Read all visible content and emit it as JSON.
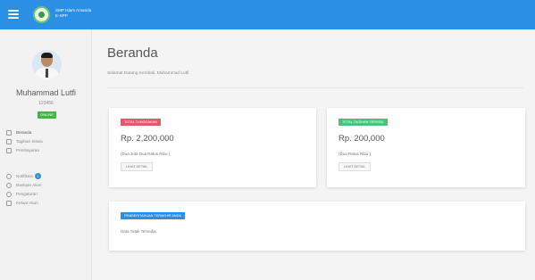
{
  "app": {
    "brand_line1": "SMP Islam Amanda",
    "brand_line2": "E-SPP"
  },
  "user": {
    "name": "Muhammad Lutfi",
    "id": "123456",
    "status": "ONLINE"
  },
  "sidebar": {
    "items": [
      {
        "label": "Beranda",
        "icon": "home-icon"
      },
      {
        "label": "Tagihan Siswa",
        "icon": "printer-icon"
      },
      {
        "label": "Pembayaran",
        "icon": "receipt-icon"
      }
    ],
    "items2": [
      {
        "label": "Notifikasi",
        "icon": "bell-icon",
        "badge": "1"
      },
      {
        "label": "Bantuan Akun",
        "icon": "help-icon"
      },
      {
        "label": "Pengaturan",
        "icon": "settings-icon"
      },
      {
        "label": "Keluar Akun",
        "icon": "logout-icon"
      }
    ]
  },
  "page": {
    "title": "Beranda",
    "subtitle": "Selamat Datang Kembali, Muhammad Lutfi"
  },
  "cards": {
    "tunggakan": {
      "label": "TOTAL TUNGGAKAN",
      "amount": "Rp. 2,200,000",
      "words": "(Dua Juta Dua Ratus Ribu )",
      "button": "LIHAT DETAIL"
    },
    "tagihan": {
      "label": "TOTAL TAGIHAN TERSISA",
      "amount": "Rp. 200,000",
      "words": "(Dua Ratus Ribu )",
      "button": "LIHAT DETAIL"
    },
    "pemberitahuan": {
      "label": "PEMBERITAHUAN TERAKHIR ANDA",
      "text": "Data Tidak Tersedia"
    }
  },
  "colors": {
    "topbar": "#2b8fe6",
    "danger": "#e05a6a",
    "success": "#4cc27a",
    "info": "#2f8de0",
    "online": "#4caf50"
  }
}
